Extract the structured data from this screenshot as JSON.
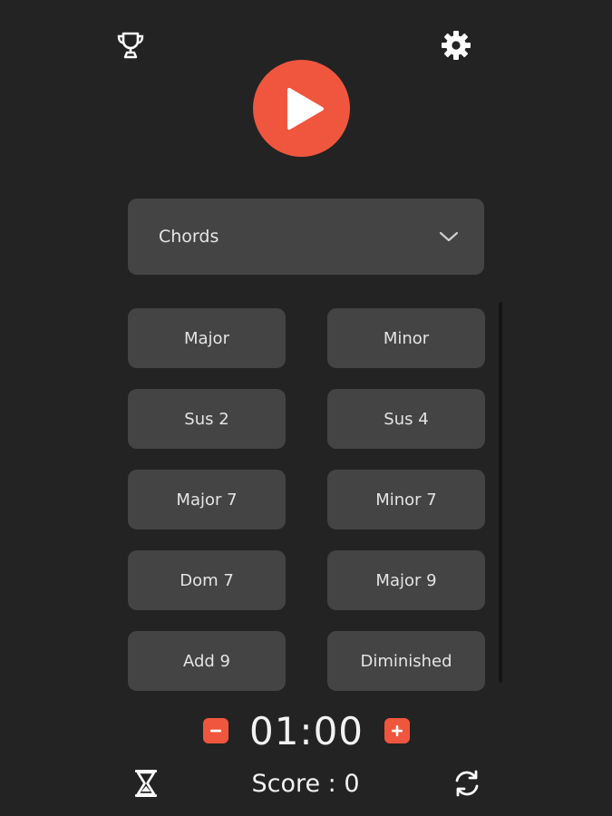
{
  "header": {
    "trophy_icon": "trophy-icon",
    "settings_icon": "gear-icon",
    "play_icon": "play-icon",
    "accent_color": "#f0563e"
  },
  "dropdown": {
    "selected": "Chords",
    "icon": "chevron-down-icon"
  },
  "chords": [
    "Major",
    "Minor",
    "Sus 2",
    "Sus 4",
    "Major 7",
    "Minor 7",
    "Dom 7",
    "Major 9",
    "Add 9",
    "Diminished"
  ],
  "timer": {
    "value": "01:00",
    "minus_icon": "minus-icon",
    "plus_icon": "plus-icon"
  },
  "footer": {
    "score_text": "Score : 0",
    "hourglass_icon": "hourglass-icon",
    "refresh_icon": "refresh-icon"
  }
}
